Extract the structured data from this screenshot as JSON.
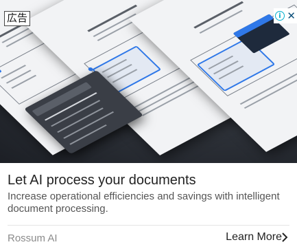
{
  "ad_label": "広告",
  "adchoices": {
    "info_icon": "info-icon",
    "close_icon": "close-icon",
    "info_symbol": "i",
    "close_symbol": "✕"
  },
  "headline": "Let AI process your documents",
  "description": "Increase operational efficiencies and savings with intelligent document processing.",
  "advertiser": "Rossum AI",
  "cta_label": "Learn More",
  "colors": {
    "accent_blue": "#2f78e8",
    "adchoices_cyan": "#00aecd",
    "headline": "#222222",
    "description": "#555555",
    "advertiser": "#8b8b8b"
  }
}
